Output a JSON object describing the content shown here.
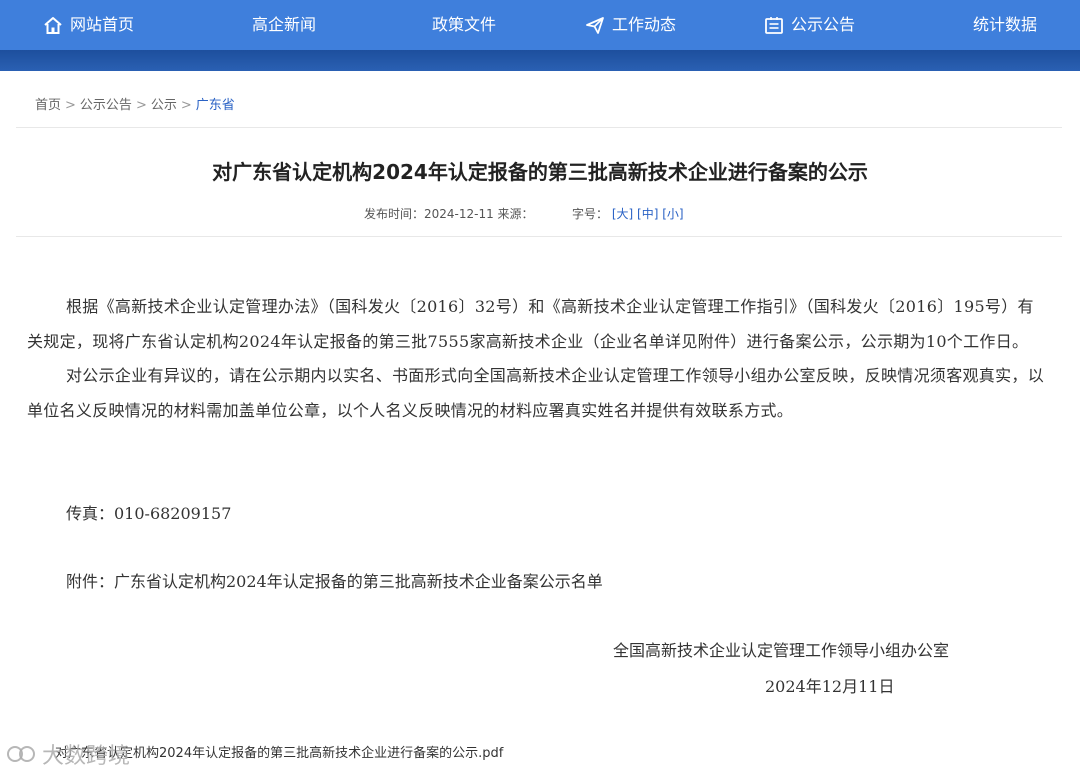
{
  "nav": {
    "items": [
      {
        "label": "网站首页",
        "icon": "home-icon"
      },
      {
        "label": "高企新闻"
      },
      {
        "label": "政策文件"
      },
      {
        "label": "工作动态",
        "icon": "send-icon"
      },
      {
        "label": "公示公告",
        "icon": "notice-icon"
      },
      {
        "label": "统计数据"
      }
    ],
    "accent": "#3f7fdc",
    "band_color": "#1d4f9d"
  },
  "breadcrumb": {
    "items": [
      "首页",
      "公示公告",
      "公示"
    ],
    "current": "广东省",
    "separator": ">"
  },
  "article": {
    "title": "对广东省认定机构2024年认定报备的第三批高新技术企业进行备案的公示",
    "publish_label": "发布时间：2024-12-11 来源：",
    "font_size_label": "字号：",
    "font_sizes": [
      "[大]",
      "[中]",
      "[小]"
    ],
    "paragraphs": [
      "根据《高新技术企业认定管理办法》（国科发火〔2016〕32号）和《高新技术企业认定管理工作指引》（国科发火〔2016〕195号）有关规定，现将广东省认定机构2024年认定报备的第三批7555家高新技术企业（企业名单详见附件）进行备案公示，公示期为10个工作日。",
      "对公示企业有异议的，请在公示期内以实名、书面形式向全国高新技术企业认定管理工作领导小组办公室反映，反映情况须客观真实，以单位名义反映情况的材料需加盖单位公章，以个人名义反映情况的材料应署真实姓名并提供有效联系方式。"
    ],
    "fax": "传真：010-68209157",
    "attachment": "附件：广东省认定机构2024年认定报备的第三批高新技术企业备案公示名单",
    "signature_org": "全国高新技术企业认定管理工作领导小组办公室",
    "signature_date": "2024年12月11日",
    "pdf_link": "对广东省认定机构2024年认定报备的第三批高新技术企业进行备案的公示.pdf"
  },
  "watermark": {
    "text": "大数跨境"
  }
}
